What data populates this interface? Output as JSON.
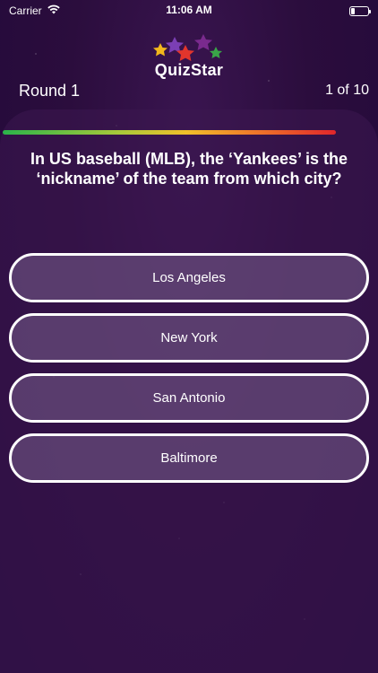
{
  "status_bar": {
    "carrier": "Carrier",
    "time": "11:06 AM"
  },
  "header": {
    "app_name": "QuizStar",
    "round_label": "Round 1",
    "progress_label": "1 of 10",
    "question_progress_fraction": 0.1
  },
  "quiz": {
    "question": "In US baseball (MLB), the ‘Yankees’ is the ‘nickname’ of the team from which city?",
    "answers": [
      {
        "label": "Los Angeles"
      },
      {
        "label": "New York"
      },
      {
        "label": "San Antonio"
      },
      {
        "label": "Baltimore"
      }
    ]
  },
  "colors": {
    "background": "#2b0d3d",
    "answer_fill": "#6a5080",
    "timer_gradient": [
      "#2bb34a",
      "#f0c02a",
      "#e0262a"
    ]
  },
  "icons": [
    "wifi-icon",
    "battery-icon",
    "quizstar-logo-icon"
  ]
}
